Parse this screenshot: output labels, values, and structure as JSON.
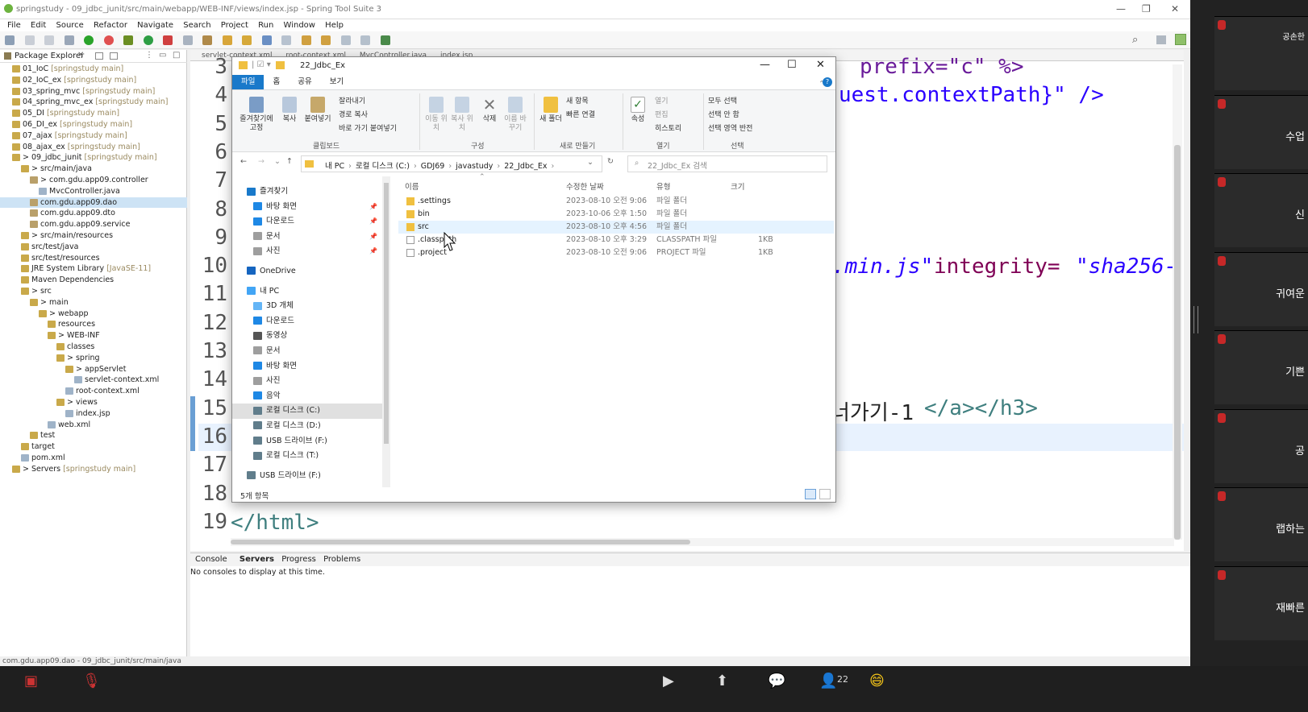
{
  "window": {
    "title": "springstudy - 09_jdbc_junit/src/main/webapp/WEB-INF/views/index.jsp - Spring Tool Suite 3"
  },
  "menu": [
    "File",
    "Edit",
    "Source",
    "Refactor",
    "Navigate",
    "Search",
    "Project",
    "Run",
    "Window",
    "Help"
  ],
  "package_explorer": {
    "title": "Package Explorer",
    "tree": [
      {
        "label": "01_IoC",
        "dim": "[springstudy main]"
      },
      {
        "label": "02_IoC_ex",
        "dim": "[springstudy main]"
      },
      {
        "label": "03_spring_mvc",
        "dim": "[springstudy main]"
      },
      {
        "label": "04_spring_mvc_ex",
        "dim": "[springstudy main]"
      },
      {
        "label": "05_DI",
        "dim": "[springstudy main]"
      },
      {
        "label": "06_DI_ex",
        "dim": "[springstudy main]"
      },
      {
        "label": "07_ajax",
        "dim": "[springstudy main]"
      },
      {
        "label": "08_ajax_ex",
        "dim": "[springstudy main]"
      },
      {
        "label": "> 09_jdbc_junit",
        "dim": "[springstudy main]"
      },
      {
        "label": "> src/main/java",
        "dim": ""
      },
      {
        "label": "> com.gdu.app09.controller",
        "dim": ""
      },
      {
        "label": "MvcController.java",
        "dim": ""
      },
      {
        "label": "com.gdu.app09.dao",
        "dim": ""
      },
      {
        "label": "com.gdu.app09.dto",
        "dim": ""
      },
      {
        "label": "com.gdu.app09.service",
        "dim": ""
      },
      {
        "label": "> src/main/resources",
        "dim": ""
      },
      {
        "label": "src/test/java",
        "dim": ""
      },
      {
        "label": "src/test/resources",
        "dim": ""
      },
      {
        "label": "JRE System Library",
        "dim": "[JavaSE-11]"
      },
      {
        "label": "Maven Dependencies",
        "dim": ""
      },
      {
        "label": "> src",
        "dim": ""
      },
      {
        "label": "> main",
        "dim": ""
      },
      {
        "label": "> webapp",
        "dim": ""
      },
      {
        "label": "resources",
        "dim": ""
      },
      {
        "label": "> WEB-INF",
        "dim": ""
      },
      {
        "label": "classes",
        "dim": ""
      },
      {
        "label": "> spring",
        "dim": ""
      },
      {
        "label": "> appServlet",
        "dim": ""
      },
      {
        "label": "servlet-context.xml",
        "dim": ""
      },
      {
        "label": "root-context.xml",
        "dim": ""
      },
      {
        "label": "> views",
        "dim": ""
      },
      {
        "label": "index.jsp",
        "dim": ""
      },
      {
        "label": "web.xml",
        "dim": ""
      },
      {
        "label": "test",
        "dim": ""
      },
      {
        "label": "target",
        "dim": ""
      },
      {
        "label": "pom.xml",
        "dim": ""
      },
      {
        "label": "> Servers",
        "dim": "[springstudy main]"
      }
    ]
  },
  "editor": {
    "tabs": [
      "servlet-context.xml",
      "root-context.xml",
      "MvcController.java",
      "index.jsp"
    ],
    "line_numbers": [
      "3",
      "4",
      "5",
      "6",
      "7",
      "8",
      "9",
      "10",
      "11",
      "12",
      "13",
      "14",
      "15",
      "16",
      "17",
      "18",
      "19"
    ],
    "code": {
      "l3": "prefix=\"c\" %>",
      "l4": "uest.contextPath}\" />",
      "l10a": ".min.js\"",
      "l10b": " integrity=",
      "l10c": "\"sha256-",
      "l15a": "너가기-1",
      "l15b": "</a></h3>",
      "l19": "</html>"
    }
  },
  "console": {
    "tabs": [
      "Console",
      "Servers",
      "Progress",
      "Problems"
    ],
    "message": "No consoles to display at this time."
  },
  "statusbar": "com.gdu.app09.dao - 09_jdbc_junit/src/main/java",
  "explorer": {
    "title": "22_Jdbc_Ex",
    "ribbon_tabs": [
      "파일",
      "홈",
      "공유",
      "보기"
    ],
    "ribbon": {
      "pin": "즐겨찾기에 고정",
      "copy": "복사",
      "paste": "붙여넣기",
      "cut": "잘라내기",
      "copy_path": "경로 복사",
      "paste_shortcut": "바로 가기 붙여넣기",
      "clipboard": "클립보드",
      "move": "이동 위치",
      "copy_to": "복사 위치",
      "delete": "삭제",
      "rename": "이름 바꾸기",
      "organize": "구성",
      "new_folder": "새 폴더",
      "new_item": "새 항목",
      "easy_access": "빠른 연결",
      "new": "새로 만들기",
      "properties": "속성",
      "open": "열기",
      "edit": "편집",
      "history": "히스토리",
      "open_group": "열기",
      "select_all": "모두 선택",
      "select_none": "선택 안 함",
      "invert": "선택 영역 반전",
      "select": "선택"
    },
    "path": [
      "내 PC",
      "로컬 디스크 (C:)",
      "GDJ69",
      "javastudy",
      "22_Jdbc_Ex"
    ],
    "search_placeholder": "22_Jdbc_Ex 검색",
    "nav": [
      {
        "label": "즐겨찾기",
        "color": "#1979ca",
        "indent": 0
      },
      {
        "label": "바탕 화면",
        "color": "#1e88e5",
        "indent": 1
      },
      {
        "label": "다운로드",
        "color": "#1e88e5",
        "indent": 1
      },
      {
        "label": "문서",
        "color": "#9e9e9e",
        "indent": 1
      },
      {
        "label": "사진",
        "color": "#9e9e9e",
        "indent": 1
      },
      {
        "label": "OneDrive",
        "color": "#1565c0",
        "indent": 0
      },
      {
        "label": "내 PC",
        "color": "#42a5f5",
        "indent": 0
      },
      {
        "label": "3D 개체",
        "color": "#64b5f6",
        "indent": 1
      },
      {
        "label": "다운로드",
        "color": "#1e88e5",
        "indent": 1
      },
      {
        "label": "동영상",
        "color": "#555",
        "indent": 1
      },
      {
        "label": "문서",
        "color": "#9e9e9e",
        "indent": 1
      },
      {
        "label": "바탕 화면",
        "color": "#1e88e5",
        "indent": 1
      },
      {
        "label": "사진",
        "color": "#9e9e9e",
        "indent": 1
      },
      {
        "label": "음악",
        "color": "#1e88e5",
        "indent": 1
      },
      {
        "label": "로컬 디스크 (C:)",
        "color": "#607d8b",
        "indent": 1
      },
      {
        "label": "로컬 디스크 (D:)",
        "color": "#607d8b",
        "indent": 1
      },
      {
        "label": "USB 드라이브 (F:)",
        "color": "#607d8b",
        "indent": 1
      },
      {
        "label": "로컬 디스크 (T:)",
        "color": "#607d8b",
        "indent": 1
      },
      {
        "label": "USB 드라이브 (F:)",
        "color": "#607d8b",
        "indent": 0
      }
    ],
    "columns": [
      "이름",
      "수정한 날짜",
      "유형",
      "크기"
    ],
    "files": [
      {
        "name": ".settings",
        "date": "2023-08-10 오전 9:06",
        "type": "파일 폴더",
        "size": "",
        "folder": true
      },
      {
        "name": "bin",
        "date": "2023-10-06 오후 1:50",
        "type": "파일 폴더",
        "size": "",
        "folder": true
      },
      {
        "name": "src",
        "date": "2023-08-10 오후 4:56",
        "type": "파일 폴더",
        "size": "",
        "folder": true
      },
      {
        "name": ".classpath",
        "date": "2023-08-10 오후 3:29",
        "type": "CLASSPATH 파일",
        "size": "1KB",
        "folder": false
      },
      {
        "name": ".project",
        "date": "2023-08-10 오전 9:06",
        "type": "PROJECT 파일",
        "size": "1KB",
        "folder": false
      }
    ],
    "status": "5개 항목"
  },
  "zoom": {
    "participants": [
      "공손한",
      "수업",
      "신",
      "귀여운",
      "기쁜",
      "공",
      "랩하는",
      "재빠른"
    ],
    "participant_count": "22"
  }
}
